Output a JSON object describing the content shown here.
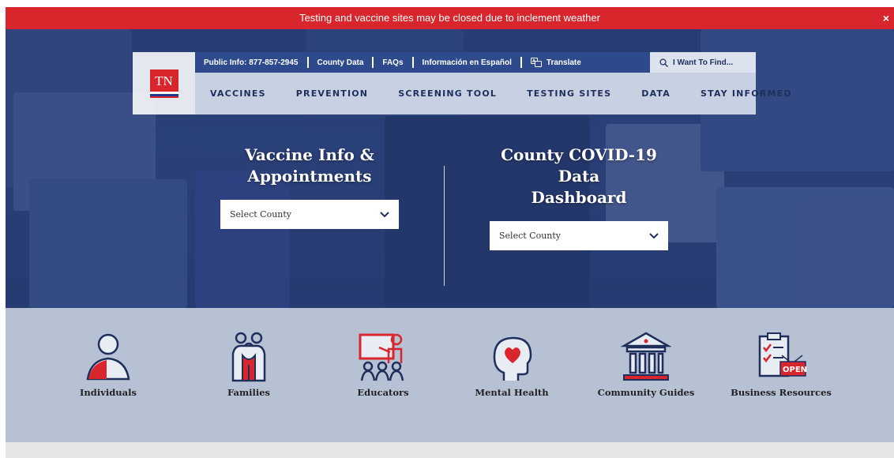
{
  "alert": {
    "text": "Testing and vaccine sites may be closed due to inclement weather",
    "close_label": "×"
  },
  "logo": {
    "text": "TN"
  },
  "utility_nav": {
    "public_info": "Public Info: 877-857-2945",
    "county_data": "County Data",
    "faqs": "FAQs",
    "espanol": "Información en Español",
    "translate": "Translate",
    "search_placeholder": "I Want To Find..."
  },
  "main_nav": [
    "VACCINES",
    "PREVENTION",
    "SCREENING TOOL",
    "TESTING SITES",
    "DATA",
    "STAY INFORMED"
  ],
  "hero": {
    "left": {
      "title_line1": "Vaccine Info &",
      "title_line2": "Appointments",
      "select_label": "Select County"
    },
    "right": {
      "title_line1": "County COVID-19 Data",
      "title_line2": "Dashboard",
      "select_label": "Select County"
    }
  },
  "categories": [
    "Individuals",
    "Families",
    "Educators",
    "Mental Health",
    "Community Guides",
    "Business Resources"
  ],
  "icons": {
    "individuals": "person-icon",
    "families": "family-icon",
    "educators": "teacher-icon",
    "mental_health": "head-heart-icon",
    "community": "government-building-icon",
    "business": "clipboard-open-sign-icon"
  },
  "colors": {
    "accent_red": "#d9262c",
    "navy": "#1e2f5c",
    "band": "#b7c1d4"
  }
}
